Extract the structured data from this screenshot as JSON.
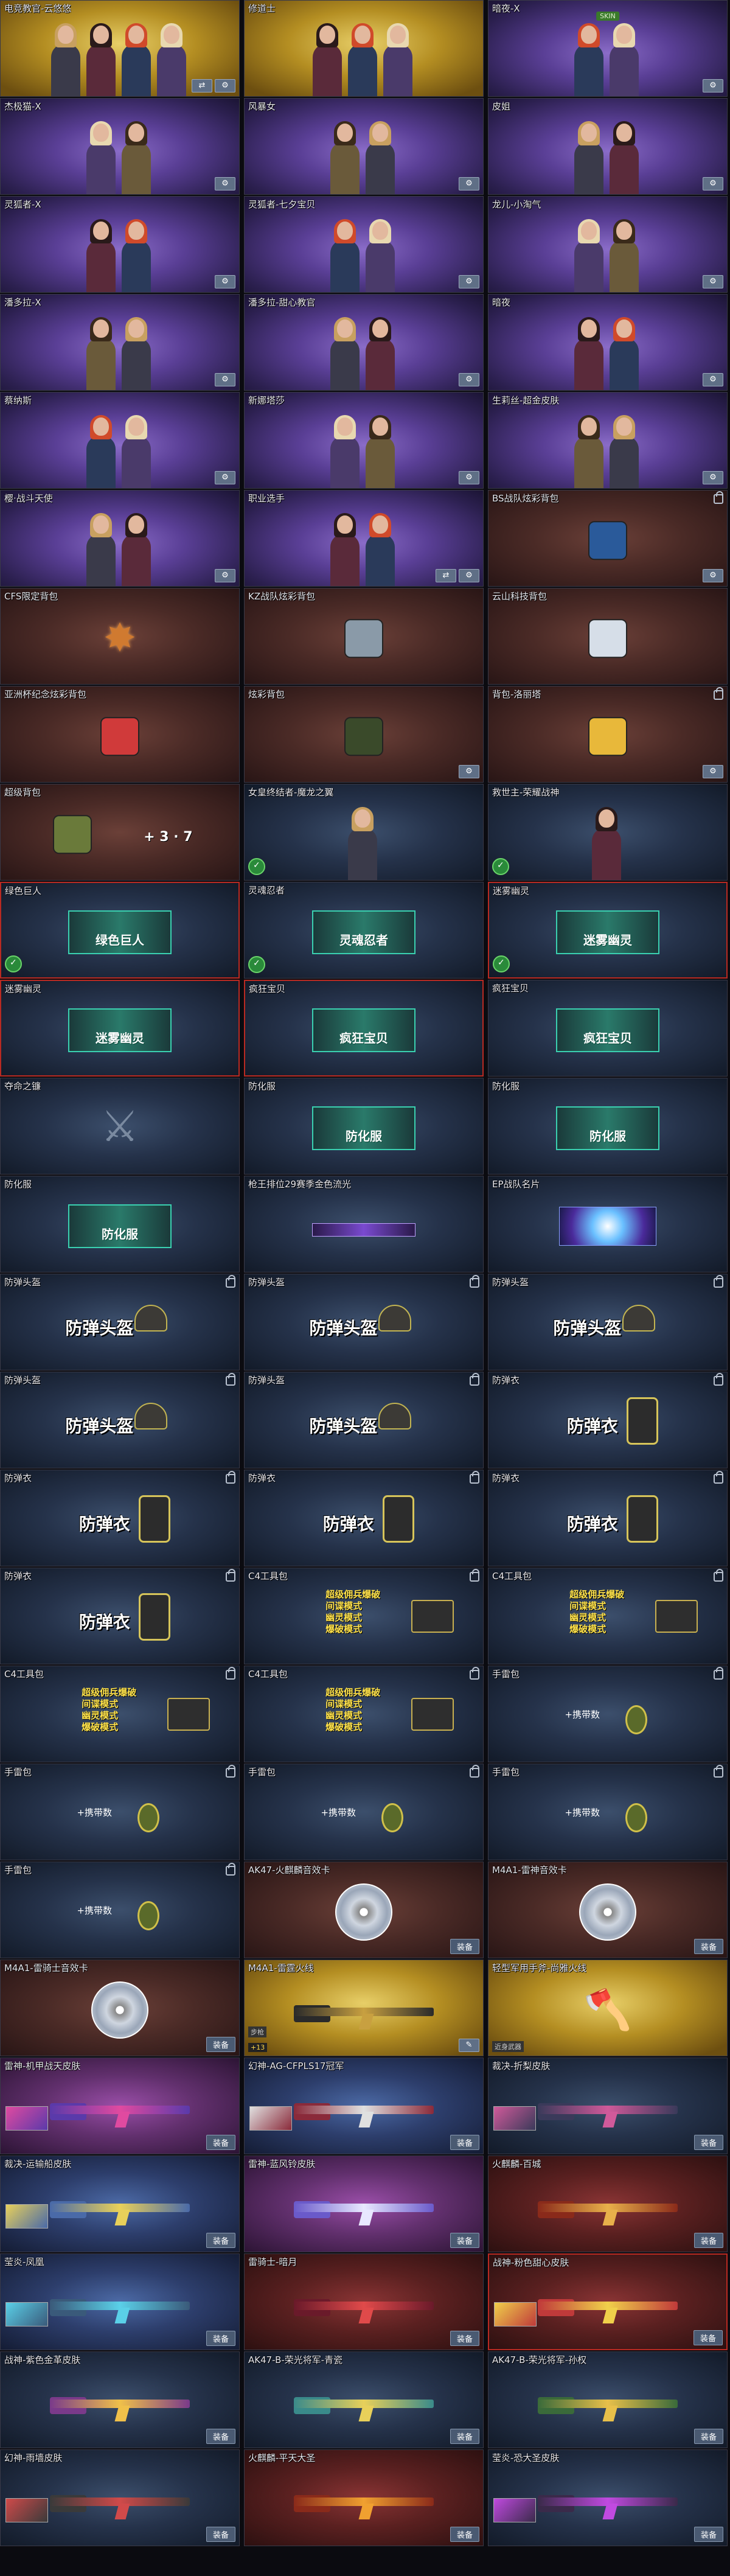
{
  "controls": {
    "settings_glyph": "⚙",
    "toggle_glyph": "⇄",
    "tools_glyph": "✎",
    "equip_label": "装备"
  },
  "cards": [
    {
      "name": "电竞教官-云悠悠",
      "type": "chars",
      "bg": "gold",
      "chars": 4,
      "tag": "",
      "controls": [
        "toggle",
        "settings"
      ]
    },
    {
      "name": "修道士",
      "type": "chars",
      "bg": "gold",
      "chars": 3,
      "tag": "",
      "controls": []
    },
    {
      "name": "暗夜-X",
      "type": "chars",
      "bg": "purple",
      "chars": 2,
      "tag": "SKIN",
      "controls": [
        "settings"
      ]
    },
    {
      "name": "杰极猫-X",
      "type": "chars",
      "bg": "purple",
      "chars": 2,
      "tag": "",
      "controls": [
        "settings"
      ]
    },
    {
      "name": "风暴女",
      "type": "chars",
      "bg": "purple",
      "chars": 2,
      "tag": "",
      "controls": [
        "settings"
      ]
    },
    {
      "name": "皮姐",
      "type": "chars",
      "bg": "purple",
      "chars": 2,
      "tag": "",
      "controls": [
        "settings"
      ]
    },
    {
      "name": "灵狐者-X",
      "type": "chars",
      "bg": "purple",
      "chars": 2,
      "tag": "",
      "controls": [
        "settings"
      ]
    },
    {
      "name": "灵狐者-七夕宝贝",
      "type": "chars",
      "bg": "purple",
      "chars": 2,
      "tag": "",
      "controls": [
        "settings"
      ]
    },
    {
      "name": "龙儿-小淘气",
      "type": "chars",
      "bg": "purple",
      "chars": 2,
      "tag": "",
      "controls": [
        "settings"
      ]
    },
    {
      "name": "潘多拉-X",
      "type": "chars",
      "bg": "purple",
      "chars": 2,
      "tag": "",
      "controls": [
        "settings"
      ]
    },
    {
      "name": "潘多拉-甜心教官",
      "type": "chars",
      "bg": "purple",
      "chars": 2,
      "tag": "",
      "controls": [
        "settings"
      ]
    },
    {
      "name": "暗夜",
      "type": "chars",
      "bg": "purple",
      "chars": 2,
      "tag": "",
      "controls": [
        "settings"
      ]
    },
    {
      "name": "蔡纳斯",
      "type": "chars",
      "bg": "purple",
      "chars": 2,
      "tag": "",
      "controls": [
        "settings"
      ]
    },
    {
      "name": "新娜塔莎",
      "type": "chars",
      "bg": "purple",
      "chars": 2,
      "tag": "",
      "controls": [
        "settings"
      ]
    },
    {
      "name": "生莉丝-超金皮肤",
      "type": "chars",
      "bg": "purple",
      "chars": 2,
      "tag": "",
      "controls": [
        "settings"
      ]
    },
    {
      "name": "樱·战斗天使",
      "type": "chars",
      "bg": "purple",
      "chars": 2,
      "tag": "",
      "controls": [
        "settings"
      ]
    },
    {
      "name": "职业选手",
      "type": "chars",
      "bg": "purple",
      "chars": 2,
      "tag": "",
      "controls": [
        "toggle",
        "settings"
      ]
    },
    {
      "name": "BS战队炫彩背包",
      "type": "bag",
      "bg": "brown",
      "color": "#2a5a9a",
      "lock": true,
      "controls": [
        "settings"
      ]
    },
    {
      "name": "CFS限定背包",
      "type": "star",
      "bg": "brown",
      "lock": false,
      "controls": []
    },
    {
      "name": "KZ战队炫彩背包",
      "type": "bag",
      "bg": "brown",
      "color": "#8a9aa8",
      "lock": false,
      "controls": []
    },
    {
      "name": "云山科技背包",
      "type": "bag",
      "bg": "brown",
      "color": "#d6dee8",
      "lock": false,
      "controls": []
    },
    {
      "name": "亚洲杯纪念炫彩背包",
      "type": "bag",
      "bg": "brown",
      "color": "#d03a3a",
      "lock": false,
      "controls": []
    },
    {
      "name": "炫彩背包",
      "type": "bag",
      "bg": "brown",
      "color": "#3a4a2a",
      "lock": false,
      "controls": [
        "settings"
      ]
    },
    {
      "name": "背包-洛丽塔",
      "type": "bag",
      "bg": "brown",
      "color": "#e8b83a",
      "lock": true,
      "controls": [
        "settings"
      ]
    },
    {
      "name": "超级背包",
      "type": "bag",
      "bg": "brown",
      "color": "#6a7a3a",
      "lock": false,
      "controls": [],
      "extra": "+ 3 · 7"
    },
    {
      "name": "女皇终结者-魔龙之翼",
      "type": "chars",
      "bg": "navy",
      "chars": 1,
      "tag": "",
      "badge": true,
      "controls": []
    },
    {
      "name": "救世主-荣耀战神",
      "type": "chars",
      "bg": "navy",
      "chars": 1,
      "tag": "",
      "badge": true,
      "controls": []
    },
    {
      "name": "绿色巨人",
      "type": "hex",
      "bg": "navy",
      "label": "绿色巨人",
      "sel": true,
      "badge": true,
      "controls": []
    },
    {
      "name": "灵魂忍者",
      "type": "hex",
      "bg": "navy",
      "label": "灵魂忍者",
      "sel": false,
      "badge": true,
      "controls": []
    },
    {
      "name": "迷雾幽灵",
      "type": "hex",
      "bg": "navy",
      "label": "迷雾幽灵",
      "sel": true,
      "badge": true,
      "controls": []
    },
    {
      "name": "迷雾幽灵",
      "type": "hex",
      "bg": "navy",
      "label": "迷雾幽灵",
      "sel": true,
      "badge": false,
      "controls": []
    },
    {
      "name": "疯狂宝贝",
      "type": "hex",
      "bg": "navy",
      "label": "疯狂宝贝",
      "sel": true,
      "badge": false,
      "controls": []
    },
    {
      "name": "疯狂宝贝",
      "type": "hex",
      "bg": "navy",
      "label": "疯狂宝贝",
      "sel": false,
      "badge": false,
      "controls": []
    },
    {
      "name": "夺命之镰",
      "type": "scythe",
      "bg": "navy",
      "lock": false,
      "controls": []
    },
    {
      "name": "防化服",
      "type": "hex",
      "bg": "navy",
      "label": "防化服",
      "sel": false,
      "badge": false,
      "controls": []
    },
    {
      "name": "防化服",
      "type": "hex",
      "bg": "navy",
      "label": "防化服",
      "sel": false,
      "badge": false,
      "controls": []
    },
    {
      "name": "防化服",
      "type": "hex",
      "bg": "navy",
      "label": "防化服",
      "sel": false,
      "badge": false,
      "controls": []
    },
    {
      "name": "枪王排位29赛季金色流光",
      "type": "strip",
      "bg": "navy",
      "controls": []
    },
    {
      "name": "EP战队名片",
      "type": "emblem",
      "bg": "navy",
      "controls": []
    },
    {
      "name": "防弹头盔",
      "type": "helm",
      "bg": "navy",
      "label": "防弹头盔",
      "lock": true
    },
    {
      "name": "防弹头盔",
      "type": "helm",
      "bg": "navy",
      "label": "防弹头盔",
      "lock": true
    },
    {
      "name": "防弹头盔",
      "type": "helm",
      "bg": "navy",
      "label": "防弹头盔",
      "lock": true
    },
    {
      "name": "防弹头盔",
      "type": "helm",
      "bg": "navy",
      "label": "防弹头盔",
      "lock": true
    },
    {
      "name": "防弹头盔",
      "type": "helm",
      "bg": "navy",
      "label": "防弹头盔",
      "lock": true
    },
    {
      "name": "防弹衣",
      "type": "vest",
      "bg": "navy",
      "label": "防弹衣",
      "lock": true
    },
    {
      "name": "防弹衣",
      "type": "vest",
      "bg": "navy",
      "label": "防弹衣",
      "lock": true
    },
    {
      "name": "防弹衣",
      "type": "vest",
      "bg": "navy",
      "label": "防弹衣",
      "lock": true
    },
    {
      "name": "防弹衣",
      "type": "vest",
      "bg": "navy",
      "label": "防弹衣",
      "lock": true
    },
    {
      "name": "防弹衣",
      "type": "vest",
      "bg": "navy",
      "label": "防弹衣",
      "lock": true
    },
    {
      "name": "C4工具包",
      "type": "c4",
      "bg": "navy",
      "lines": [
        "超级佣兵爆破",
        "间谍模式",
        "幽灵模式",
        "爆破模式"
      ],
      "lock": true
    },
    {
      "name": "C4工具包",
      "type": "c4",
      "bg": "navy",
      "lines": [
        "超级佣兵爆破",
        "间谍模式",
        "幽灵模式",
        "爆破模式"
      ],
      "lock": true
    },
    {
      "name": "C4工具包",
      "type": "c4",
      "bg": "navy",
      "lines": [
        "超级佣兵爆破",
        "间谍模式",
        "幽灵模式",
        "爆破模式"
      ],
      "lock": true
    },
    {
      "name": "C4工具包",
      "type": "c4",
      "bg": "navy",
      "lines": [
        "超级佣兵爆破",
        "间谍模式",
        "幽灵模式",
        "爆破模式"
      ],
      "lock": true
    },
    {
      "name": "手雷包",
      "type": "grenade",
      "bg": "navy",
      "label": "+携带数",
      "lock": true
    },
    {
      "name": "手雷包",
      "type": "grenade",
      "bg": "navy",
      "label": "+携带数",
      "lock": true
    },
    {
      "name": "手雷包",
      "type": "grenade",
      "bg": "navy",
      "label": "+携带数",
      "lock": true
    },
    {
      "name": "手雷包",
      "type": "grenade",
      "bg": "navy",
      "label": "+携带数",
      "lock": true
    },
    {
      "name": "手雷包",
      "type": "grenade",
      "bg": "navy",
      "label": "+携带数",
      "lock": true
    },
    {
      "name": "AK47-火麒麟音效卡",
      "type": "disc",
      "bg": "brown",
      "equip": true
    },
    {
      "name": "M4A1-雷神音效卡",
      "type": "disc",
      "bg": "brown",
      "equip": true
    },
    {
      "name": "M4A1-雷骑士音效卡",
      "type": "disc",
      "bg": "brown",
      "equip": true
    },
    {
      "name": "M4A1-雷霆火线",
      "type": "gun",
      "bg": "gold",
      "gun": "#2a2a2a",
      "accent": "#c8a040",
      "level": "+13",
      "mark": "步枪",
      "tools": true
    },
    {
      "name": "轻型军用手斧-尚雅火线",
      "type": "axe",
      "bg": "gold",
      "mark": "近身武器",
      "tools": false
    },
    {
      "name": "雷神-机甲战天皮肤",
      "type": "gun",
      "bg": "magenta",
      "gun": "#5a3aaa",
      "accent": "#e04aa0",
      "sticker": true,
      "equip": true
    },
    {
      "name": "幻神-AG-CFPLS17冠军",
      "type": "gun",
      "bg": "blue",
      "gun": "#8a2a3a",
      "accent": "#e0e0e0",
      "sticker": true,
      "equip": true
    },
    {
      "name": "裁决-折梨皮肤",
      "type": "gun",
      "bg": "navy",
      "gun": "#3a3a5a",
      "accent": "#d05a9a",
      "sticker": true,
      "equip": true
    },
    {
      "name": "裁决-运输船皮肤",
      "type": "gun",
      "bg": "blue",
      "gun": "#4a6aa8",
      "accent": "#e8d05a",
      "sticker": true,
      "equip": true
    },
    {
      "name": "雷神-蓝风铃皮肤",
      "type": "gun",
      "bg": "magenta",
      "gun": "#6a5aca",
      "accent": "#e8e8ff",
      "sticker": false,
      "equip": true
    },
    {
      "name": "火麒麟-百城",
      "type": "gun",
      "bg": "red",
      "gun": "#8a2a1a",
      "accent": "#e8b04a",
      "sticker": false,
      "equip": true
    },
    {
      "name": "莹炎-凤凰",
      "type": "gun",
      "bg": "blue",
      "gun": "#3a5a7a",
      "accent": "#5ad0e8",
      "sticker": true,
      "equip": true
    },
    {
      "name": "雷骑士-暗月",
      "type": "gun",
      "bg": "red",
      "gun": "#6a1a2a",
      "accent": "#e04a4a",
      "sticker": false,
      "equip": true
    },
    {
      "name": "战神-粉色甜心皮肤",
      "type": "gun",
      "bg": "red",
      "gun": "#c03a3a",
      "accent": "#f0d04a",
      "sticker": true,
      "sel": true,
      "equip": true
    },
    {
      "name": "战神-紫色金革皮肤",
      "type": "gun",
      "bg": "navy",
      "gun": "#7a3a8a",
      "accent": "#f0c04a",
      "sticker": false,
      "equip": true
    },
    {
      "name": "AK47-B-荣光将军-青瓷",
      "type": "gun",
      "bg": "navy",
      "gun": "#3a8a8a",
      "accent": "#e8d05a",
      "sticker": false,
      "equip": true
    },
    {
      "name": "AK47-B-荣光将军-孙权",
      "type": "gun",
      "bg": "navy",
      "gun": "#3a6a3a",
      "accent": "#e8c04a",
      "sticker": false,
      "equip": true
    },
    {
      "name": "幻神-雨墙皮肤",
      "type": "gun",
      "bg": "navy",
      "gun": "#3a3a3a",
      "accent": "#d04a4a",
      "sticker": true,
      "equip": true
    },
    {
      "name": "火麒麟-平天大圣",
      "type": "gun",
      "bg": "red",
      "gun": "#8a2a1a",
      "accent": "#f0a030",
      "sticker": false,
      "equip": true
    },
    {
      "name": "莹炎-恐大圣皮肤",
      "type": "gun",
      "bg": "navy",
      "gun": "#3a2a4a",
      "accent": "#c04ae0",
      "sticker": true,
      "equip": true
    }
  ]
}
